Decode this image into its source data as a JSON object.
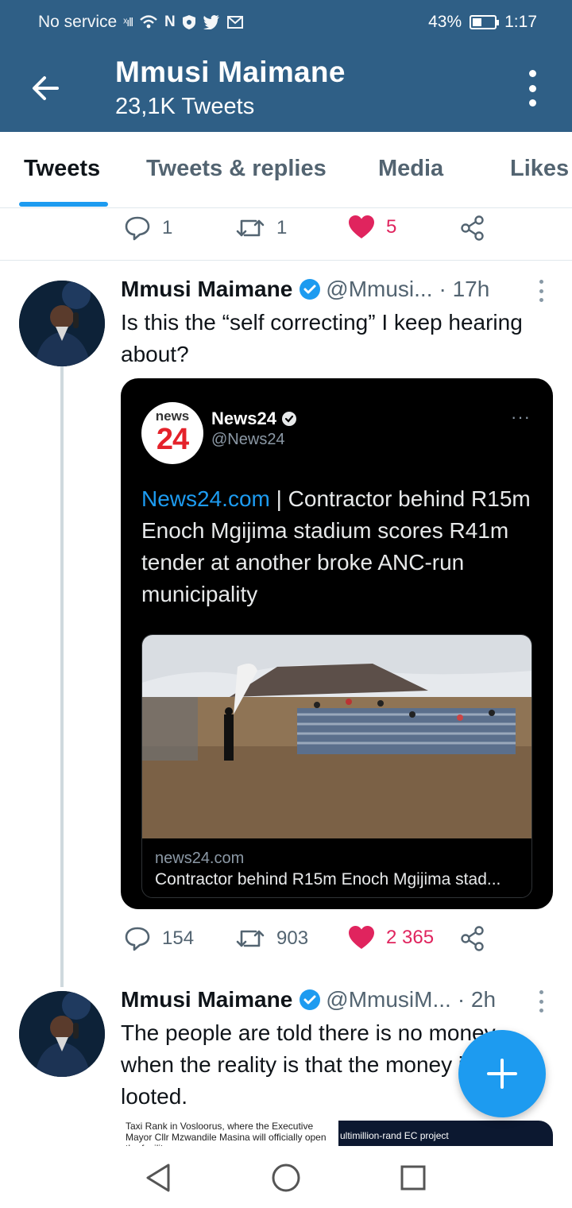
{
  "status_bar": {
    "carrier": "No service",
    "battery": "43%",
    "battery_level": 0.43,
    "time": "1:17",
    "icons": [
      "signal-icon",
      "wifi-icon",
      "n-app-icon",
      "vpn-shield-icon",
      "twitter-icon",
      "gmail-icon"
    ]
  },
  "header": {
    "title": "Mmusi Maimane",
    "subtitle": "23,1K Tweets",
    "icons": [
      "back-arrow-icon",
      "more-vertical-icon"
    ]
  },
  "tabs": [
    {
      "label": "Tweets",
      "active": true
    },
    {
      "label": "Tweets & replies",
      "active": false
    },
    {
      "label": "Media",
      "active": false
    },
    {
      "label": "Likes",
      "active": false
    }
  ],
  "prev_actions": {
    "replies": "1",
    "retweets": "1",
    "likes": "5"
  },
  "tweets": [
    {
      "name": "Mmusi Maimane",
      "handle": "@Mmusi...",
      "time": "· 17h",
      "text": "Is this the “self correcting” I keep hearing about?",
      "quoted": {
        "logo_small": "news",
        "logo_big": "24",
        "name": "News24",
        "handle": "@News24",
        "more": "···",
        "link_text": "News24.com",
        "text": " | Contractor behind R15m Enoch Mgijima stadium scores R41m tender at another broke ANC-run municipality",
        "card_domain": "news24.com",
        "card_headline": "Contractor behind R15m Enoch Mgijima stad..."
      },
      "actions": {
        "replies": "154",
        "retweets": "903",
        "likes": "2 365"
      }
    },
    {
      "name": "Mmusi Maimane",
      "handle": "@MmusiM...",
      "time": "· 2h",
      "text": "The people are told there is no money when the reality is that the money is being looted.",
      "preview_left": "Taxi Rank in Vosloorus, where the Executive Mayor Cllr Mzwandile Masina will officially open the facility",
      "preview_right": "ultimillion-rand EC project"
    }
  ],
  "colors": {
    "header_bg": "#2f5f86",
    "accent": "#1d9bf0",
    "like": "#e0245e",
    "muted": "#536471"
  },
  "nav": {
    "icons": [
      "nav-back-icon",
      "nav-home-icon",
      "nav-recents-icon"
    ]
  }
}
